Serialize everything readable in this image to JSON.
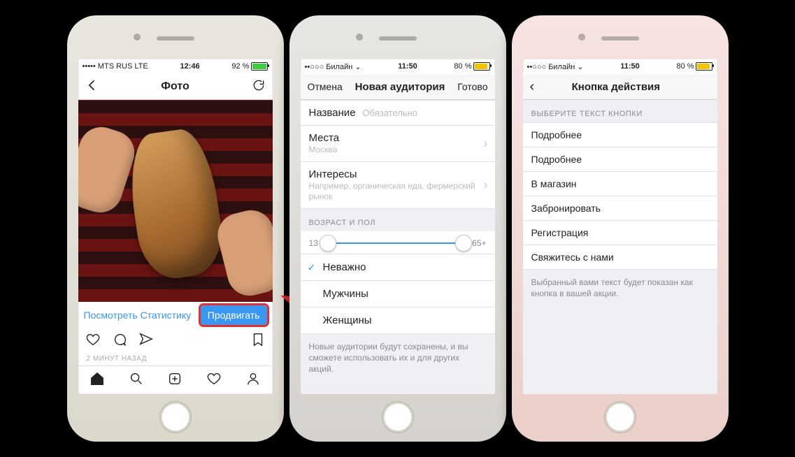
{
  "phone1": {
    "status": {
      "carrier": "••••• MTS RUS   LTE",
      "time": "12:46",
      "battery": "92 %"
    },
    "nav": {
      "title": "Фото"
    },
    "stats_link": "Посмотреть Статистику",
    "promote_btn": "Продвигать",
    "timestamp": "2 МИНУТ НАЗАД"
  },
  "phone2": {
    "status": {
      "carrier": "••○○○ Билайн ⌄",
      "time": "11:50",
      "battery": "80 %"
    },
    "nav": {
      "cancel": "Отмена",
      "title": "Новая аудитория",
      "done": "Готово"
    },
    "name": {
      "label": "Название",
      "placeholder": "Обязательно"
    },
    "places": {
      "label": "Места",
      "sub": "Москва"
    },
    "interests": {
      "label": "Интересы",
      "sub": "Например, органическая еда, фермерский рынок"
    },
    "age_section": "Возраст и пол",
    "age_min": "13",
    "age_max": "65+",
    "gender": {
      "any": "Неважно",
      "male": "Мужчины",
      "female": "Женщины"
    },
    "footnote": "Новые аудитории будут сохранены, и вы сможете использовать их и для других акций."
  },
  "phone3": {
    "status": {
      "carrier": "••○○○ Билайн ⌄",
      "time": "11:50",
      "battery": "80 %"
    },
    "nav": {
      "title": "Кнопка действия"
    },
    "section": "Выберите текст кнопки",
    "options": [
      "Подробнее",
      "Подробнее",
      "В магазин",
      "Забронировать",
      "Регистрация",
      "Свяжитесь с нами"
    ],
    "footnote": "Выбранный вами текст будет показан как кнопка в вашей акции."
  }
}
